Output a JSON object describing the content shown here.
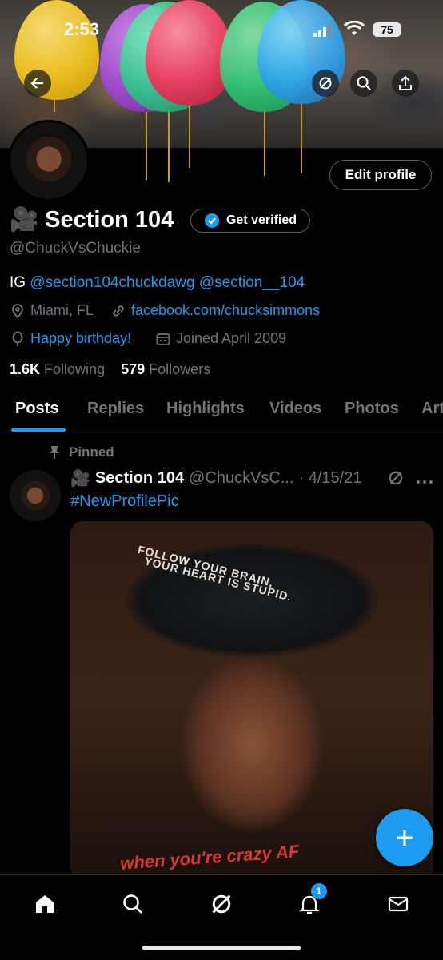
{
  "status_bar": {
    "time": "2:53",
    "battery": "75"
  },
  "profile": {
    "display_name": "Section 104",
    "name_emoji": "🎥",
    "get_verified_label": "Get verified",
    "handle": "@ChuckVsChuckie",
    "edit_profile_label": "Edit profile",
    "bio_prefix": "IG",
    "bio_link_1": "@section104chuckdawg",
    "bio_link_2": "@section__104",
    "location": "Miami, FL",
    "website": "facebook.com/chucksimmons",
    "birthday": "Happy birthday!",
    "joined": "Joined April 2009",
    "following_count": "1.6K",
    "following_label": "Following",
    "followers_count": "579",
    "followers_label": "Followers"
  },
  "tabs": [
    {
      "label": "Posts",
      "active": true
    },
    {
      "label": "Replies"
    },
    {
      "label": "Highlights"
    },
    {
      "label": "Videos"
    },
    {
      "label": "Photos"
    },
    {
      "label": "Art"
    }
  ],
  "pinned_post": {
    "pinned_label": "Pinned",
    "author_emoji": "🎥",
    "author_name": "Section 104",
    "author_handle": "@ChuckVsC...",
    "date": "· 4/15/21",
    "text": "#NewProfilePic",
    "image_text_1": "FOLLOW YOUR BRAIN,",
    "image_text_2": "YOUR HEART IS STUPID.",
    "image_text_3": "when you're crazy AF"
  },
  "bottom_nav": {
    "notifications_badge": "1"
  },
  "colors": {
    "accent": "#1d9bf0",
    "background": "#000000",
    "muted": "#71767b",
    "balloon_string": "#c79a34"
  },
  "icons": [
    "back-arrow-icon",
    "grok-icon",
    "search-icon",
    "share-icon",
    "verified-badge-icon",
    "location-icon",
    "link-icon",
    "balloon-icon",
    "calendar-icon",
    "pin-icon",
    "grok-icon",
    "more-icon",
    "plus-icon",
    "home-icon",
    "search-icon",
    "grok-icon",
    "bell-icon",
    "mail-icon"
  ]
}
